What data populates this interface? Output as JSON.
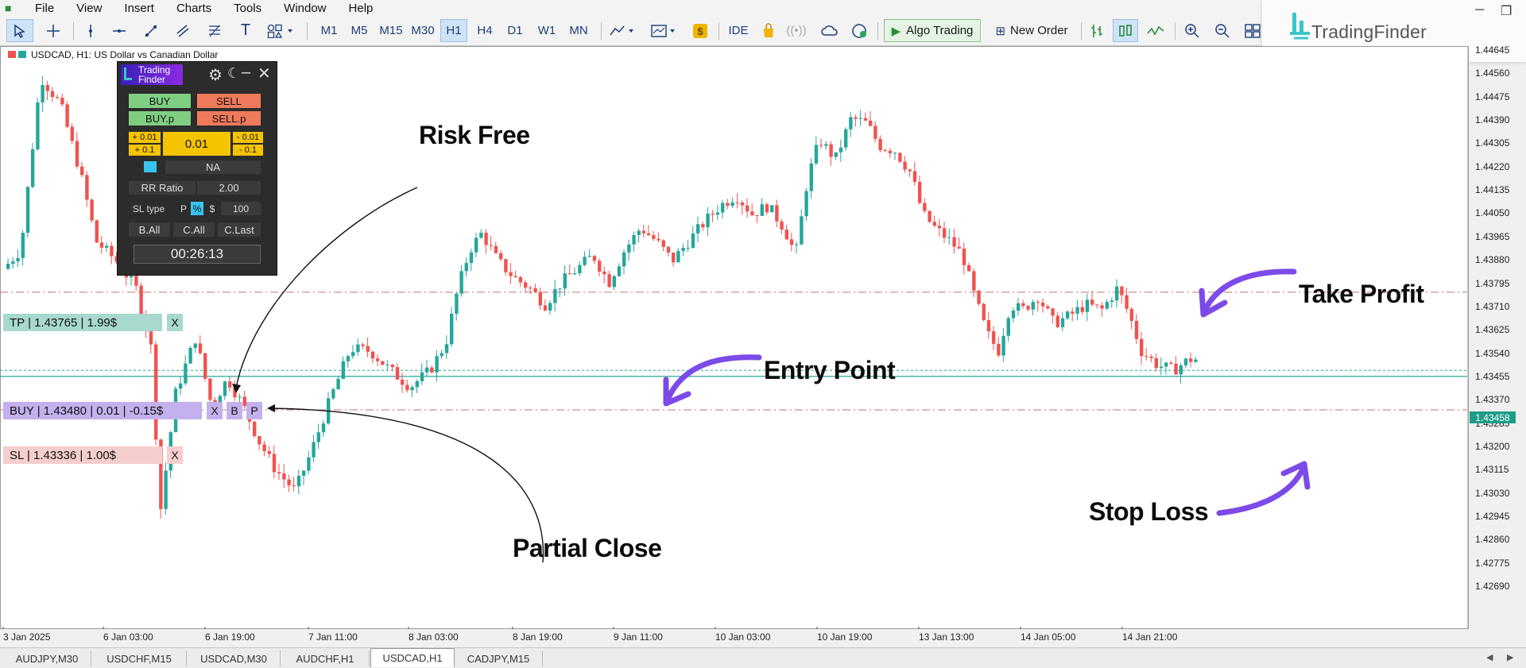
{
  "menu": {
    "app_icon": "bars-icon",
    "items": [
      "File",
      "View",
      "Insert",
      "Charts",
      "Tools",
      "Window",
      "Help"
    ]
  },
  "toolbar": {
    "timeframes": [
      "M1",
      "M5",
      "M15",
      "M30",
      "H1",
      "H4",
      "D1",
      "W1",
      "MN"
    ],
    "selected_timeframe": "H1",
    "ide_label": "IDE",
    "algo_trading_label": "Algo Trading",
    "new_order_label": "New Order"
  },
  "brand": {
    "name": "TradingFinder",
    "accent": "#3bc4c8"
  },
  "chart": {
    "title": "USDCAD, H1:  US Dollar vs Canadian Dollar",
    "symbol": "USDCAD",
    "timeframe": "H1",
    "current_price": "1.43458",
    "bull_color": "#26a69a",
    "bear_color": "#ef5350",
    "price_ticks": [
      "1.44645",
      "1.44560",
      "1.44475",
      "1.44390",
      "1.44305",
      "1.44220",
      "1.44135",
      "1.44050",
      "1.43965",
      "1.43880",
      "1.43795",
      "1.43710",
      "1.43625",
      "1.43540",
      "1.43455",
      "1.43370",
      "1.43285",
      "1.43200",
      "1.43115",
      "1.43030",
      "1.42945",
      "1.42860",
      "1.42775",
      "1.42690"
    ],
    "time_ticks": [
      "3 Jan 2025",
      "6 Jan 03:00",
      "6 Jan 19:00",
      "7 Jan 11:00",
      "8 Jan 03:00",
      "8 Jan 19:00",
      "9 Jan 11:00",
      "10 Jan 03:00",
      "10 Jan 19:00",
      "13 Jan 13:00",
      "14 Jan 05:00",
      "14 Jan 21:00"
    ]
  },
  "trade_lines": {
    "tp": {
      "label": "TP | 1.43765 | 1.99$",
      "price": 1.43765,
      "color": "#cf8d8d",
      "bg": "#a7d9cf"
    },
    "buy": {
      "label": "BUY | 1.43480 | 0.01 | -0.15$",
      "price": 1.4348,
      "color": "#26a69a",
      "bg": "#c3b0ec"
    },
    "sl": {
      "label": "SL | 1.43336 | 1.00$",
      "price": 1.43336,
      "color": "#cf8d8d",
      "bg": "#f5cece"
    },
    "close_btn": "X",
    "b_btn": "B",
    "p_btn": "P"
  },
  "panel": {
    "logo_line1": "Trading",
    "logo_line2": "Finder",
    "buy": "BUY",
    "sell": "SELL",
    "buy_p": "BUY.p",
    "sell_p": "SELL.p",
    "plus_001": "+ 0.01",
    "plus_01": "+ 0.1",
    "lot": "0.01",
    "minus_001": "- 0.01",
    "minus_01": "- 0.1",
    "na": "NA",
    "rr_label": "RR Ratio",
    "rr_value": "2.00",
    "sl_type_label": "SL type",
    "sl_p": "P",
    "sl_pct": "%",
    "sl_usd": "$",
    "sl_value": "100",
    "b_all": "B.All",
    "c_all": "C.All",
    "c_last": "C.Last",
    "timer": "00:26:13"
  },
  "annotations": {
    "risk_free": "Risk Free",
    "partial_close": "Partial Close",
    "entry_point": "Entry Point",
    "take_profit": "Take Profit",
    "stop_loss": "Stop Loss",
    "arrow_color": "#7b4ae8"
  },
  "tabs": {
    "items": [
      "AUDJPY,M30",
      "USDCHF,M15",
      "USDCAD,M30",
      "AUDCHF,H1",
      "USDCAD,H1",
      "CADJPY,M15"
    ],
    "active": "USDCAD,H1"
  }
}
